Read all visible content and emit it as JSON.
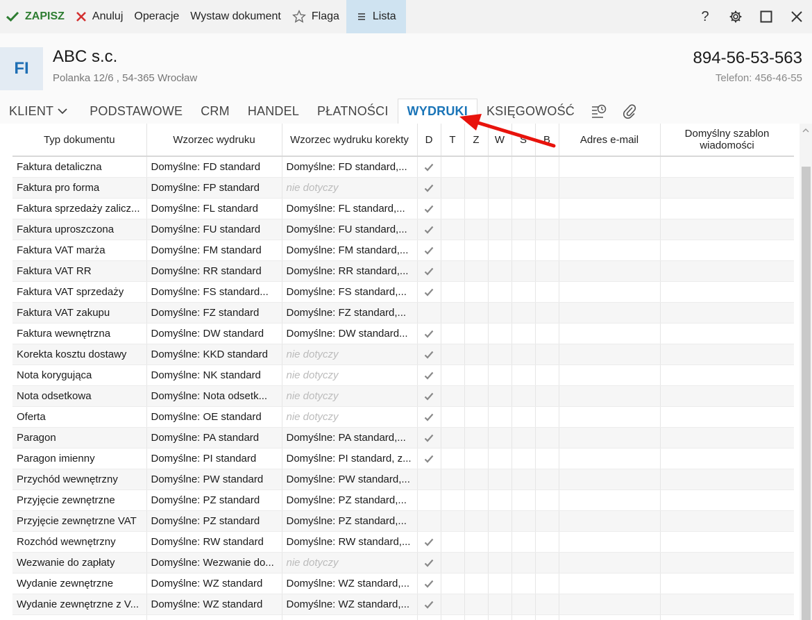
{
  "toolbar": {
    "save": "ZAPISZ",
    "cancel": "Anuluj",
    "operations": "Operacje",
    "issue_document": "Wystaw dokument",
    "flag": "Flaga",
    "list": "Lista"
  },
  "header": {
    "avatar": "FI",
    "company": "ABC s.c.",
    "address": "Polanka  12/6 , 54-365 Wrocław",
    "nip": "894-56-53-563",
    "phone": "Telefon: 456-46-55"
  },
  "tabs": [
    "KLIENT",
    "PODSTAWOWE",
    "CRM",
    "HANDEL",
    "PŁATNOŚCI",
    "WYDRUKI",
    "KSIĘGOWOŚĆ"
  ],
  "active_tab": "WYDRUKI",
  "colors": {
    "accent": "#1b75b8",
    "save_green": "#2e7d32",
    "cancel_red": "#d32f2f",
    "arrow_red": "#e8130c"
  },
  "grid": {
    "columns": [
      "Typ dokumentu",
      "Wzorzec wydruku",
      "Wzorzec wydruku korekty",
      "D",
      "T",
      "Z",
      "W",
      "S",
      "B",
      "Adres e-mail",
      "Domyślny szablon wiadomości"
    ],
    "rows": [
      {
        "type": "Faktura detaliczna",
        "pattern": "Domyślne: FD standard",
        "correction": "Domyślne: FD standard,...",
        "na": false,
        "d": true
      },
      {
        "type": "Faktura pro forma",
        "pattern": "Domyślne: FP standard",
        "correction": "nie dotyczy",
        "na": true,
        "d": true
      },
      {
        "type": "Faktura sprzedaży zalicz...",
        "pattern": "Domyślne: FL standard",
        "correction": "Domyślne: FL standard,...",
        "na": false,
        "d": true
      },
      {
        "type": "Faktura uproszczona",
        "pattern": "Domyślne: FU standard",
        "correction": "Domyślne: FU standard,...",
        "na": false,
        "d": true
      },
      {
        "type": "Faktura VAT marża",
        "pattern": "Domyślne: FM standard",
        "correction": "Domyślne: FM standard,...",
        "na": false,
        "d": true
      },
      {
        "type": "Faktura VAT RR",
        "pattern": "Domyślne: RR standard",
        "correction": "Domyślne: RR standard,...",
        "na": false,
        "d": true
      },
      {
        "type": "Faktura VAT sprzedaży",
        "pattern": "Domyślne: FS standard...",
        "correction": "Domyślne: FS standard,...",
        "na": false,
        "d": true
      },
      {
        "type": "Faktura VAT zakupu",
        "pattern": "Domyślne: FZ standard",
        "correction": "Domyślne: FZ standard,...",
        "na": false,
        "d": false
      },
      {
        "type": "Faktura wewnętrzna",
        "pattern": "Domyślne: DW standard",
        "correction": "Domyślne: DW standard...",
        "na": false,
        "d": true
      },
      {
        "type": "Korekta kosztu dostawy",
        "pattern": "Domyślne: KKD standard",
        "correction": "nie dotyczy",
        "na": true,
        "d": true
      },
      {
        "type": "Nota korygująca",
        "pattern": "Domyślne: NK standard",
        "correction": "nie dotyczy",
        "na": true,
        "d": true
      },
      {
        "type": "Nota odsetkowa",
        "pattern": "Domyślne: Nota odsetk...",
        "correction": "nie dotyczy",
        "na": true,
        "d": true
      },
      {
        "type": "Oferta",
        "pattern": "Domyślne: OE standard",
        "correction": "nie dotyczy",
        "na": true,
        "d": true
      },
      {
        "type": "Paragon",
        "pattern": "Domyślne: PA standard",
        "correction": "Domyślne: PA standard,...",
        "na": false,
        "d": true
      },
      {
        "type": "Paragon imienny",
        "pattern": "Domyślne: PI standard",
        "correction": "Domyślne: PI standard, z...",
        "na": false,
        "d": true
      },
      {
        "type": "Przychód wewnętrzny",
        "pattern": "Domyślne: PW standard",
        "correction": "Domyślne: PW standard,...",
        "na": false,
        "d": false
      },
      {
        "type": "Przyjęcie zewnętrzne",
        "pattern": "Domyślne: PZ standard",
        "correction": "Domyślne: PZ standard,...",
        "na": false,
        "d": false
      },
      {
        "type": "Przyjęcie zewnętrzne VAT",
        "pattern": "Domyślne: PZ standard",
        "correction": "Domyślne: PZ standard,...",
        "na": false,
        "d": false
      },
      {
        "type": "Rozchód wewnętrzny",
        "pattern": "Domyślne: RW standard",
        "correction": "Domyślne: RW standard,...",
        "na": false,
        "d": true
      },
      {
        "type": "Wezwanie do zapłaty",
        "pattern": "Domyślne: Wezwanie do...",
        "correction": "nie dotyczy",
        "na": true,
        "d": true
      },
      {
        "type": "Wydanie zewnętrzne",
        "pattern": "Domyślne: WZ standard",
        "correction": "Domyślne: WZ standard,...",
        "na": false,
        "d": true
      },
      {
        "type": "Wydanie zewnętrzne z V...",
        "pattern": "Domyślne: WZ standard",
        "correction": "Domyślne: WZ standard,...",
        "na": false,
        "d": true
      },
      {
        "type": "",
        "pattern": "",
        "correction": "",
        "na": false,
        "d": true
      }
    ]
  }
}
